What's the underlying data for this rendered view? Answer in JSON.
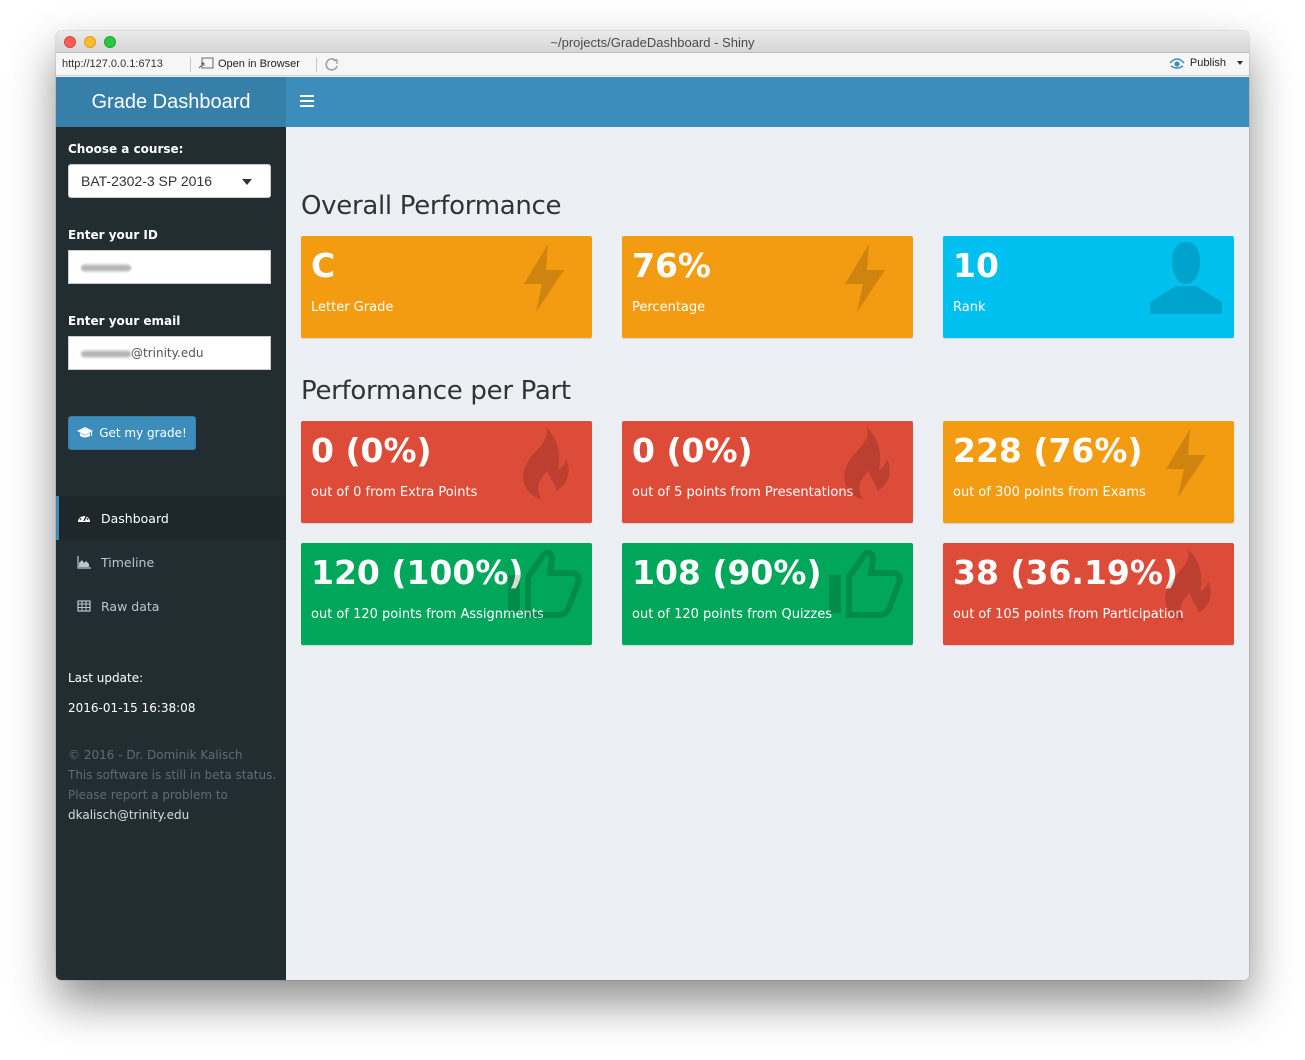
{
  "window": {
    "title": "~/projects/GradeDashboard - Shiny",
    "url": "http://127.0.0.1:6713",
    "open_in_browser_label": "Open in Browser",
    "publish_label": "Publish"
  },
  "header": {
    "app_title": "Grade Dashboard",
    "menu_toggle_icon": "hamburger-icon"
  },
  "sidebar": {
    "course_label": "Choose a course:",
    "course_selected": "BAT-2302-3 SP 2016",
    "id_label": "Enter your ID",
    "id_value": "",
    "email_label": "Enter your email",
    "email_value": "@trinity.edu",
    "submit_label": "Get my grade!",
    "submit_icon": "graduation-cap-icon",
    "menu": [
      {
        "label": "Dashboard",
        "icon": "dashboard-icon",
        "active": true
      },
      {
        "label": "Timeline",
        "icon": "area-chart-icon",
        "active": false
      },
      {
        "label": "Raw data",
        "icon": "table-icon",
        "active": false
      }
    ],
    "last_update_label": "Last update:",
    "last_update_value": "2016-01-15 16:38:08",
    "footer_lines": [
      "© 2016 - Dr. Dominik Kalisch",
      "This software is still in beta status.",
      "Please report a problem to"
    ],
    "footer_email": "dkalisch@trinity.edu"
  },
  "main": {
    "overall_title": "Overall Performance",
    "overall_boxes": [
      {
        "value": "C",
        "subtitle": "Letter Grade",
        "color": "orange",
        "icon": "bolt-icon"
      },
      {
        "value": "76%",
        "subtitle": "Percentage",
        "color": "orange",
        "icon": "bolt-icon"
      },
      {
        "value": "10",
        "subtitle": "Rank",
        "color": "aqua",
        "icon": "user-icon"
      }
    ],
    "parts_title": "Performance per Part",
    "part_boxes": [
      {
        "value": "0 (0%)",
        "subtitle": "out of 0 from Extra Points",
        "color": "red",
        "icon": "fire-icon"
      },
      {
        "value": "0 (0%)",
        "subtitle": "out of 5 points from Presentations",
        "color": "red",
        "icon": "fire-icon"
      },
      {
        "value": "228 (76%)",
        "subtitle": "out of 300 points from Exams",
        "color": "orange",
        "icon": "bolt-icon"
      },
      {
        "value": "120 (100%)",
        "subtitle": "out of 120 points from Assignments",
        "color": "green",
        "icon": "thumbs-up-icon"
      },
      {
        "value": "108 (90%)",
        "subtitle": "out of 120 points from Quizzes",
        "color": "green",
        "icon": "thumbs-up-icon"
      },
      {
        "value": "38 (36.19%)",
        "subtitle": "out of 105 points from Participation",
        "color": "red",
        "icon": "fire-icon"
      }
    ]
  },
  "colors": {
    "orange": "#f39c12",
    "aqua": "#00c0ef",
    "red": "#dd4b39",
    "green": "#00a65a",
    "primary": "#3c8dbc",
    "sidebar_bg": "#222d32"
  }
}
